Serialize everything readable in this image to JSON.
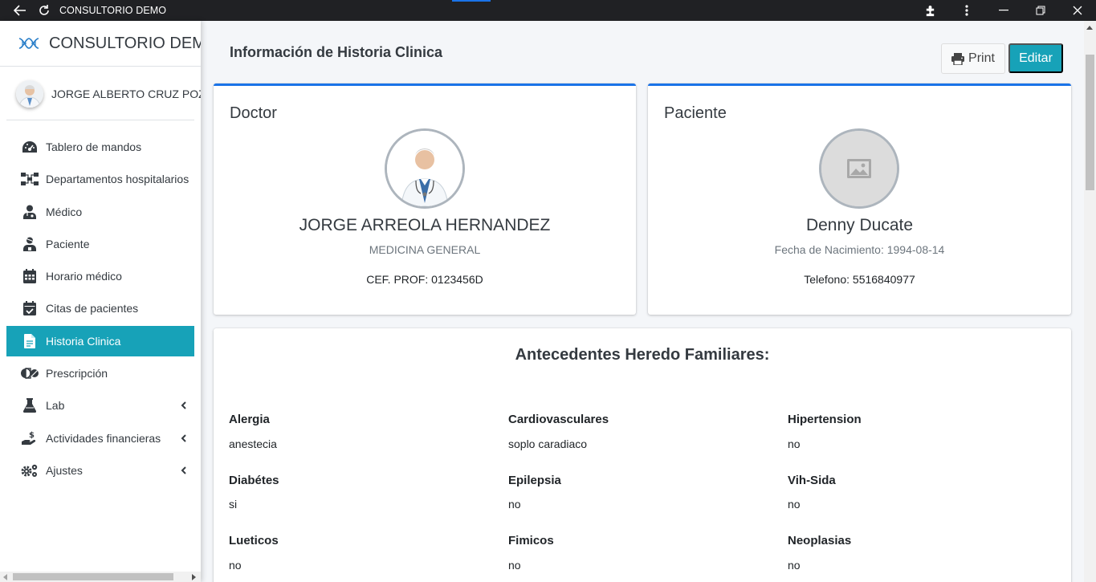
{
  "window": {
    "title": "CONSULTORIO DEMO",
    "icons": [
      "back-arrow-icon",
      "reload-icon",
      "extensions-icon",
      "more-vert-icon",
      "minimize-icon",
      "restore-icon",
      "close-icon"
    ]
  },
  "sidebar": {
    "brand": "CONSULTORIO DEMO",
    "user_name": "JORGE ALBERTO CRUZ POZOS",
    "items": [
      {
        "label": "Tablero de mandos",
        "icon": "gauge-icon",
        "active": false,
        "submenu": false
      },
      {
        "label": "Departamentos hospitalarios",
        "icon": "sitemap-icon",
        "active": false,
        "submenu": false
      },
      {
        "label": "Médico",
        "icon": "user-doctor-icon",
        "active": false,
        "submenu": false
      },
      {
        "label": "Paciente",
        "icon": "user-injured-icon",
        "active": false,
        "submenu": false
      },
      {
        "label": "Horario médico",
        "icon": "calendar-icon",
        "active": false,
        "submenu": false
      },
      {
        "label": "Citas de pacientes",
        "icon": "calendar-check-icon",
        "active": false,
        "submenu": false
      },
      {
        "label": "Historia Clinica",
        "icon": "file-icon",
        "active": true,
        "submenu": false
      },
      {
        "label": "Prescripción",
        "icon": "pills-icon",
        "active": false,
        "submenu": false
      },
      {
        "label": "Lab",
        "icon": "flask-icon",
        "active": false,
        "submenu": true
      },
      {
        "label": "Actividades financieras",
        "icon": "hand-dollar-icon",
        "active": false,
        "submenu": true
      },
      {
        "label": "Ajustes",
        "icon": "cogs-icon",
        "active": false,
        "submenu": true
      }
    ]
  },
  "header": {
    "title": "Información de Historia Clinica",
    "print_label": "Print",
    "edit_label": "Editar"
  },
  "doctor": {
    "card_title": "Doctor",
    "name": "JORGE ARREOLA HERNANDEZ",
    "specialty": "MEDICINA GENERAL",
    "license": "CEF. PROF: 0123456D"
  },
  "patient": {
    "card_title": "Paciente",
    "name": "Denny Ducate",
    "birth": "Fecha de Nacimiento: 1994-08-14",
    "phone": "Telefono: 5516840977"
  },
  "antecedentes": {
    "title": "Antecedentes Heredo Familiares:",
    "fields": [
      {
        "label": "Alergia",
        "value": "anestecia"
      },
      {
        "label": "Cardiovasculares",
        "value": "soplo caradiaco"
      },
      {
        "label": "Hipertension",
        "value": "no"
      },
      {
        "label": "Diabétes",
        "value": "si"
      },
      {
        "label": "Epilepsia",
        "value": "no"
      },
      {
        "label": "Vih-Sida",
        "value": "no"
      },
      {
        "label": "Lueticos",
        "value": "no"
      },
      {
        "label": "Fimicos",
        "value": "no"
      },
      {
        "label": "Neoplasias",
        "value": "no"
      }
    ]
  },
  "colors": {
    "accent": "#17a2b8",
    "card_border": "#1a73e8",
    "titlebar": "#202124"
  }
}
